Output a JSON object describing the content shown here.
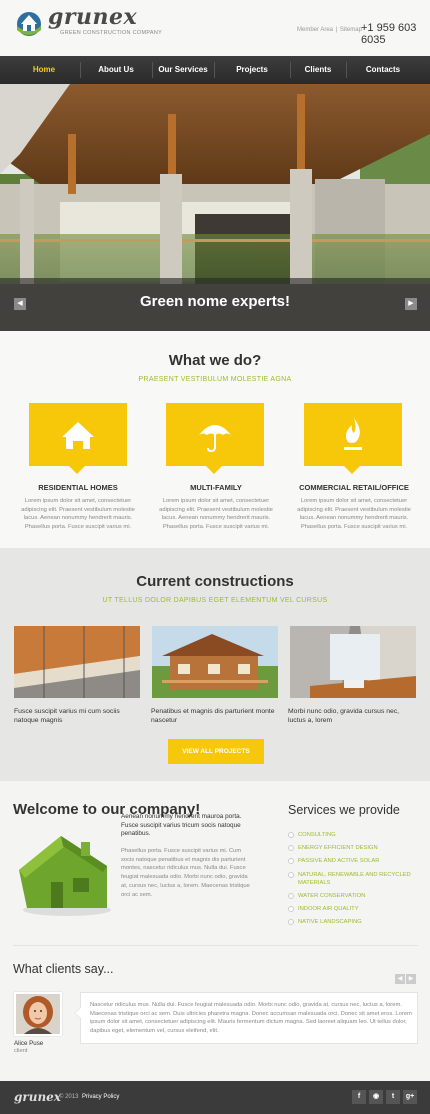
{
  "header": {
    "logo_text": "grunex",
    "logo_tagline": "GREEN CONSTRUCTION COMPANY",
    "member_area": "Member Area",
    "link_separator": "|",
    "sitemap": "Sitemap",
    "phone": "+1 959 603 6035"
  },
  "nav": {
    "items": [
      "Home",
      "About Us",
      "Our Services",
      "Projects",
      "Clients",
      "Contacts"
    ],
    "active": "Home"
  },
  "hero": {
    "caption": "Green nome experts!",
    "prev_icon": "arrow-left-icon",
    "next_icon": "arrow-right-icon"
  },
  "what_we_do": {
    "title": "What we do?",
    "subtitle": "PRAESENT VESTIBULUM MOLESTIE AGNA",
    "services": [
      {
        "icon": "house-icon",
        "title": "RESIDENTIAL HOMES",
        "text": "Lorem ipsum dolor sit amet, consectetuer adipiscing elit. Praesent vestibulum molestie lacus. Aenean nonummy hendrerit mauris. Phasellus porta. Fusce suscipit varius mi."
      },
      {
        "icon": "umbrella-icon",
        "title": "MULTI-FAMILY",
        "text": "Lorem ipsum dolor sit amet, consectetuer adipiscing elit. Praesent vestibulum molestie lacus. Aenean nonummy hendrerit mauris. Phasellus porta. Fusce suscipit varius mi."
      },
      {
        "icon": "flame-icon",
        "title": "COMMERCIAL RETAIL/OFFICE",
        "text": "Lorem ipsum dolor sit amet, consectetuer adipiscing elit. Praesent vestibulum molestie lacus. Aenean nonummy hendrerit mauris. Phasellus porta. Fusce suscipit varius mi."
      }
    ]
  },
  "current_constructions": {
    "title": "Current constructions",
    "subtitle": "UT TELLUS DOLOR DAPIBUS EGET ELEMENTUM VEL CURSUS",
    "projects": [
      {
        "caption": "Fusce suscipit varius mi cum sociis natoque magnis"
      },
      {
        "caption": "Penatibus et magnis dis parturient monte nascetur"
      },
      {
        "caption": "Morbi nunc odio, gravida cursus nec, luctus a, lorem"
      }
    ],
    "view_all": "VIEW ALL PROJECTS"
  },
  "welcome": {
    "title": "Welcome to our company!",
    "lead": "Aenean nonummy hendrerit mauroa porta. Fusce suscipit varius tricum socis natoque penatibus.",
    "body": "Phasellus porta. Fusce suscipit varius mi. Cum socis natoque penatibus et magnis dis parturient montes, nascetur ridiculus mus. Nulla dui. Fusce feugiat malesuada odio. Morbi nunc odio, gravida at, cursus nec, luctus a, lorem. Maecenas tristique orci ac sem."
  },
  "services_provide": {
    "title": "Services we provide",
    "items": [
      "CONSULTING",
      "ENERGY EFFICIENT DESIGN",
      "PASSIVE AND ACTIVE SOLAR",
      "NATURAL, RENEWABLE AND RECYCLED MATERIALS",
      "WATER CONSERVATION",
      "INDOOR AIR QUALITY",
      "NATIVE LANDSCAPING"
    ]
  },
  "clients": {
    "title": "What clients say...",
    "name": "Alice Puse",
    "role": "client",
    "quote": "Nascetur ridiculus mus. Nulla dui. Fusce feugiat malesuada odio. Morbi nunc odio, gravida at, cursus nec, luctus a, lorem. Maecenas tristique orci ac sem. Duis ultricies pharetra magna. Donec accumsan malesuada orci. Donec sit amet eros. Lorem ipsum dolor sit amet, consectetuer adipiscing elit. Mauris fermentum dictum magna. Sed laoreet aliquam leo. Ut tellus dolor, dapibus eget, elementum vel, cursus eleifend, elit."
  },
  "footer": {
    "logo": "grunex",
    "copyright": "© 2013",
    "privacy": "Privacy Policy",
    "social": [
      {
        "icon": "facebook-icon",
        "glyph": "f"
      },
      {
        "icon": "rss-icon",
        "glyph": "◉"
      },
      {
        "icon": "twitter-icon",
        "glyph": "t"
      },
      {
        "icon": "google-plus-icon",
        "glyph": "g+"
      }
    ]
  },
  "colors": {
    "accent": "#f7c80a",
    "green": "#9cbc2b",
    "nav_bg": "#333333",
    "footer_bg": "#3b3b3b"
  }
}
